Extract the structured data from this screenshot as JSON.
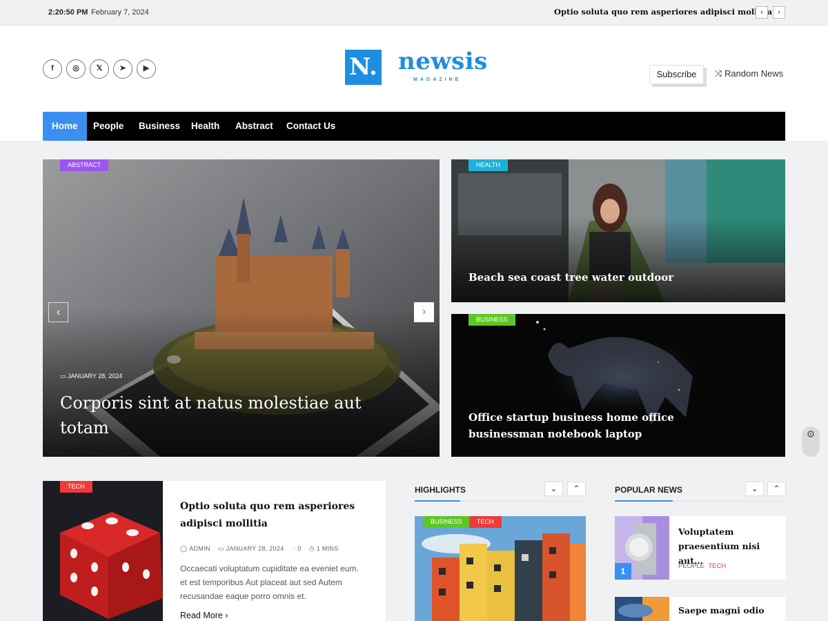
{
  "topbar": {
    "time": "2:20:50 PM",
    "date": "February 7, 2024",
    "ticker": "Optio soluta quo rem asperiores adipisci mollitia",
    "prev_icon": "‹",
    "next_icon": "›"
  },
  "header": {
    "social": [
      {
        "icon": "facebook-icon",
        "glyph": "f"
      },
      {
        "icon": "instagram-icon",
        "glyph": "◎"
      },
      {
        "icon": "x-icon",
        "glyph": "𝕏"
      },
      {
        "icon": "telegram-icon",
        "glyph": "➤"
      },
      {
        "icon": "youtube-icon",
        "glyph": "▶"
      }
    ],
    "logo_letter": "N.",
    "logo_name": "newsis",
    "logo_sub": "MAGAZINE",
    "subscribe_label": "Subscribe",
    "random_label": "Random News",
    "random_icon": "⤨"
  },
  "nav": {
    "items": [
      "Home",
      "People",
      "Business",
      "Health",
      "Abstract",
      "Contact Us"
    ]
  },
  "featured": {
    "main": {
      "category": "ABSTRACT",
      "date": "JANUARY 28, 2024",
      "title": "Corporis sint at natus molestiae aut totam"
    },
    "side1": {
      "category": "HEALTH",
      "title": "Beach sea coast tree water outdoor"
    },
    "side2": {
      "category": "BUSINESS",
      "title": "Office startup business home office businessman notebook laptop"
    }
  },
  "post": {
    "category": "TECH",
    "title": "Optio soluta quo rem asperiores adipisci mollitia",
    "author": "ADMIN",
    "date": "JANUARY 28, 2024",
    "comments": "0",
    "read_time": "1 MINS",
    "excerpt": "Occaecati voluptatum cupiditate ea eveniet eum. et est temporibus Aut placeat aut sed Autem recusandae eaque porro omnis et.",
    "read_more": "Read More"
  },
  "highlights": {
    "heading": "HIGHLIGHTS",
    "categories": [
      "BUSINESS",
      "TECH"
    ]
  },
  "popular": {
    "heading": "POPULAR NEWS",
    "items": [
      {
        "rank": "1",
        "title": "Voluptatem praesentium nisi aut...",
        "tags": [
          "PEOPLE",
          "TECH"
        ]
      },
      {
        "title": "Saepe magni odio"
      }
    ]
  },
  "colors": {
    "accent": "#3b8ff0",
    "abstract": "#9b55f0",
    "health": "#1cb2d8",
    "business": "#5ec525",
    "tech": "#ee3a3a"
  }
}
